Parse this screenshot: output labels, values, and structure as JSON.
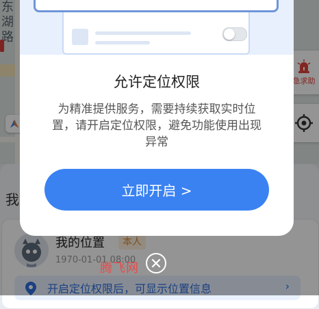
{
  "map": {
    "street_text": "东湖路",
    "sos_label": "急求助"
  },
  "sheet": {
    "tab_label": "我",
    "card": {
      "name": "我的位置",
      "badge": "本人",
      "timestamp": "1970-01-01 08:00",
      "location_tip": "开启定位权限后，可显示位置信息",
      "tip_arrow": "›"
    }
  },
  "dialog": {
    "title": "允许定位权限",
    "body": "为精准提供服务，需要持续获取实时位置，请开启定位权限，避免功能使用出现异常",
    "button_label": "立即开启 >"
  },
  "watermark": "腾飞网",
  "colors": {
    "primary": "#3a82f2",
    "badge_bg": "#fdf0dc",
    "badge_text": "#d6893a",
    "sos_red": "#e0423a"
  },
  "icons": {
    "close": "close-icon",
    "locate": "crosshair-icon",
    "sos": "siren-icon",
    "compass": "compass-icon",
    "pin": "location-pin-icon"
  }
}
